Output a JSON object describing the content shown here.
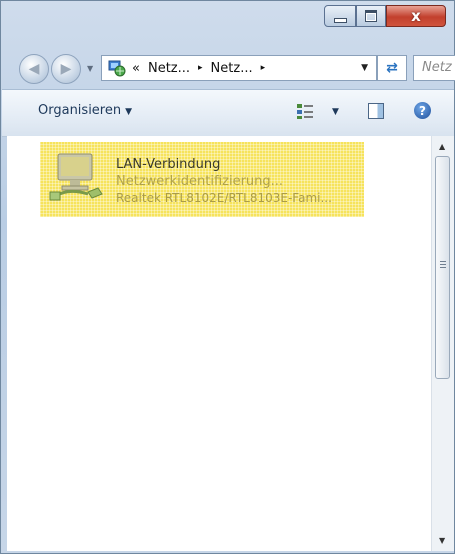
{
  "window": {
    "controls": {
      "minimize_icon": "minimize-icon",
      "maximize_icon": "maximize-icon",
      "close_label": "x"
    }
  },
  "navigation": {
    "back_icon": "back-arrow-icon",
    "forward_icon": "forward-arrow-icon",
    "address": {
      "overflow_marker": "«",
      "segments": [
        "Netz...",
        "Netz..."
      ],
      "separator": "▸"
    },
    "refresh_icon": "refresh-icon",
    "search_placeholder": "Netz"
  },
  "toolbar": {
    "organize_label": "Organisieren",
    "organize_caret": "▼",
    "view_caret": "▼",
    "help_label": "?"
  },
  "content": {
    "items": [
      {
        "name": "LAN-Verbindung",
        "status": "Netzwerkidentifizierung...",
        "device": "Realtek RTL8102E/RTL8103E-Fami...",
        "selected": true,
        "highlight_color": "#f6e35c"
      }
    ]
  },
  "scrollbar": {
    "up": "▲",
    "down": "▼"
  }
}
